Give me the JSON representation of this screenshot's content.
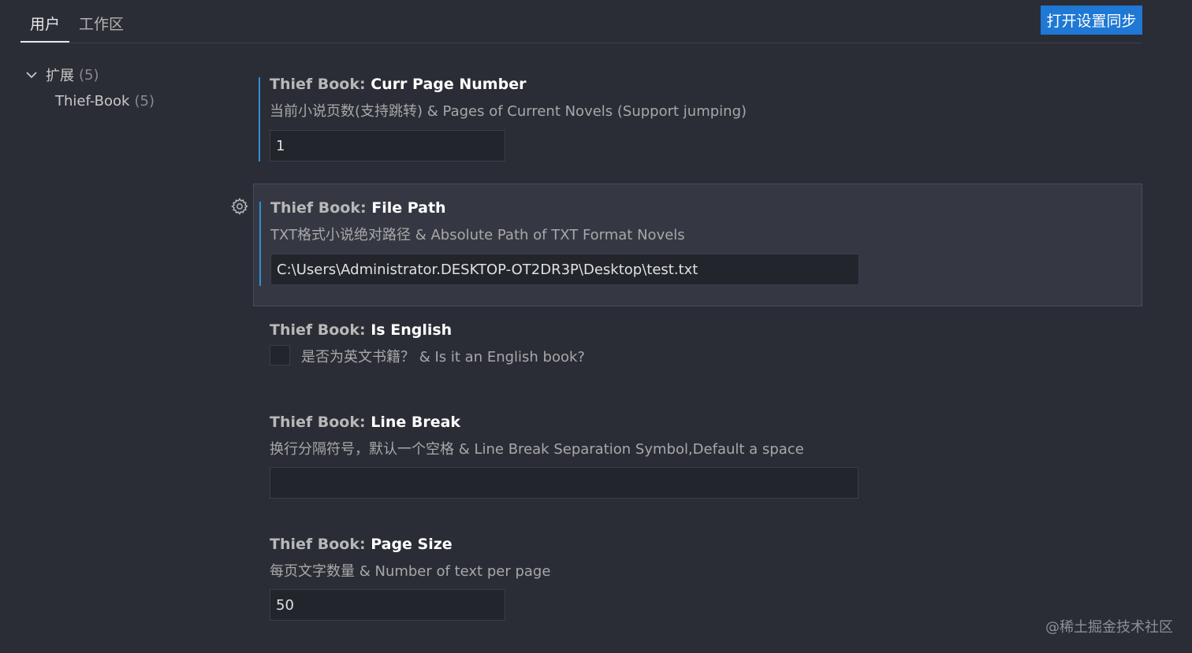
{
  "tabs": [
    {
      "label": "用户",
      "active": true
    },
    {
      "label": "工作区",
      "active": false
    }
  ],
  "sync_button": "打开设置同步",
  "tree": {
    "group_label": "扩展",
    "group_count": "(5)",
    "child_label": "Thief-Book",
    "child_count": "(5)"
  },
  "settings": {
    "curr_page": {
      "category": "Thief Book: ",
      "name": "Curr Page Number",
      "description": "当前小说页数(支持跳转) & Pages of Current Novels (Support jumping)",
      "value": "1"
    },
    "file_path": {
      "category": "Thief Book: ",
      "name": "File Path",
      "description": "TXT格式小说绝对路径 & Absolute Path of TXT Format Novels",
      "value": "C:\\Users\\Administrator.DESKTOP-OT2DR3P\\Desktop\\test.txt"
    },
    "is_english": {
      "category": "Thief Book: ",
      "name": "Is English",
      "description": "是否为英文书籍？ & Is it an English book?",
      "checked": false
    },
    "line_break": {
      "category": "Thief Book: ",
      "name": "Line Break",
      "description": "换行分隔符号，默认一个空格 & Line Break Separation Symbol,Default a space",
      "value": ""
    },
    "page_size": {
      "category": "Thief Book: ",
      "name": "Page Size",
      "description": "每页文字数量 & Number of text per page",
      "value": "50"
    }
  },
  "watermark": "@稀土掘金技术社区",
  "colors": {
    "background": "#2b2d36",
    "accent": "#1e78d4",
    "modified_bar": "#2f8fd6"
  }
}
